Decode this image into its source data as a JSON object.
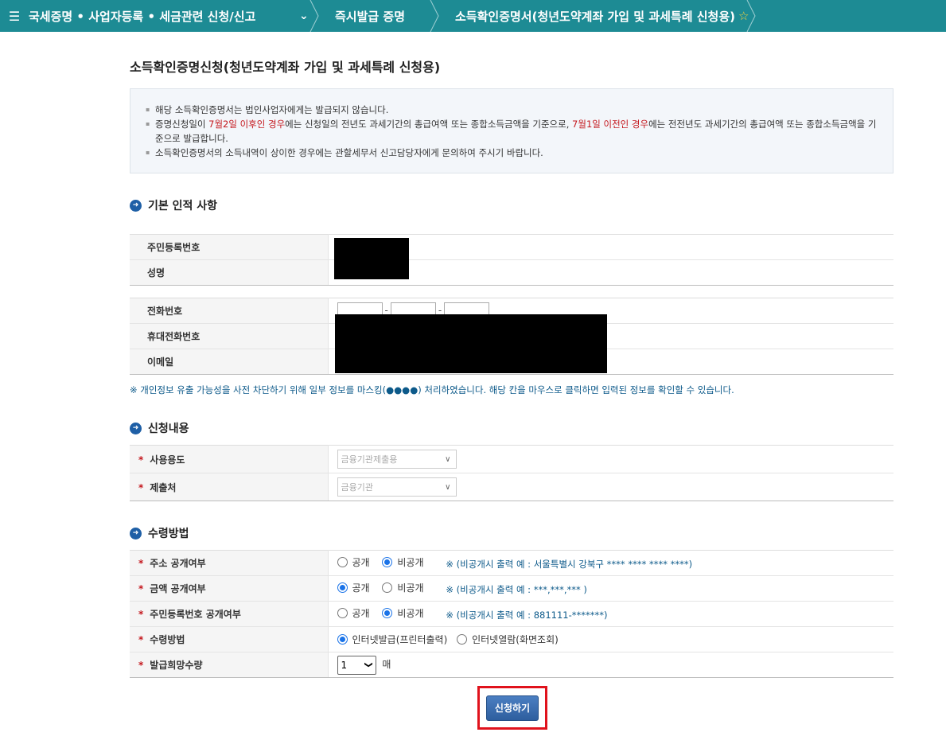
{
  "nav": {
    "menu_title": "국세증명 • 사업자등록 • 세금관련 신청/신고",
    "crumb2": "즉시발급 증명",
    "crumb3": "소득확인증명서(청년도약계좌 가입 및 과세특례 신청용)"
  },
  "page_title": "소득확인증명신청(청년도약계좌 가입 및 과세특례 신청용)",
  "notice": {
    "line1": "해당 소득확인증명서는 법인사업자에게는 발급되지 않습니다.",
    "line2_a": "증명신청일이 ",
    "line2_b": "7월2일 이후인 경우",
    "line2_c": "에는 신청일의 전년도 과세기간의 총급여액 또는 종합소득금액을 기준으로, ",
    "line2_d": "7월1일 이전인 경우",
    "line2_e": "에는 전전년도 과세기간의 총급여액 또는 종합소득금액을 기준으로 발급합니다.",
    "line3": "소득확인증명서의 소득내역이 상이한 경우에는 관할세무서 신고담당자에게 문의하여 주시기 바랍니다."
  },
  "basic": {
    "title": "기본 인적 사항",
    "rrn_label": "주민등록번호",
    "name_label": "성명",
    "phone_label": "전화번호",
    "mobile_label": "휴대전화번호",
    "email_label": "이메일",
    "dash": "-"
  },
  "mask_note": "※ 개인정보 유출 가능성을 사전 차단하기 위해 일부 정보를 마스킹(●●●●) 처리하였습니다. 해당 칸을 마우스로 클릭하면 입력된 정보를 확인할 수 있습니다.",
  "apply": {
    "title": "신청내용",
    "purpose_label": "사용용도",
    "purpose_value": "금융기관제출용",
    "dest_label": "제출처",
    "dest_value": "금융기관"
  },
  "receive": {
    "title": "수령방법",
    "addr_label": "주소 공개여부",
    "amount_label": "금액 공개여부",
    "rrn_label": "주민등록번호 공개여부",
    "method_label": "수령방법",
    "qty_label": "발급희망수량",
    "public": "공개",
    "private": "비공개",
    "addr_hint": "※ (비공개시 출력 예 : 서울특별시 강북구 **** **** **** ****)",
    "amount_hint": "※ (비공개시 출력 예 : ***,***,*** )",
    "rrn_hint": "※ (비공개시 출력 예 : 881111-*******)",
    "method_print": "인터넷발급(프린터출력)",
    "method_view": "인터넷열람(화면조회)",
    "qty_value": "1",
    "qty_unit": "매"
  },
  "submit_label": "신청하기",
  "colors": {
    "nav_bg": "#1d8b94",
    "accent_red": "#c4161c",
    "button_blue": "#2e5e9e"
  }
}
